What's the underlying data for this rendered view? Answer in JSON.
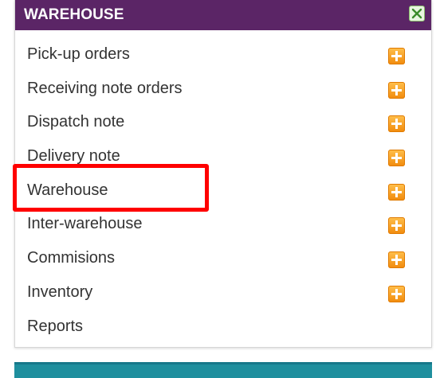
{
  "panel": {
    "title": "WAREHOUSE",
    "header_color": "#5b2566",
    "close_icon": "close-icon"
  },
  "menu": {
    "items": [
      {
        "label": "Pick-up orders",
        "has_add": true
      },
      {
        "label": "Receiving note orders",
        "has_add": true
      },
      {
        "label": "Dispatch note",
        "has_add": true
      },
      {
        "label": "Delivery note",
        "has_add": true
      },
      {
        "label": "Warehouse",
        "has_add": true,
        "highlighted": true
      },
      {
        "label": "Inter-warehouse",
        "has_add": true
      },
      {
        "label": "Commisions",
        "has_add": true
      },
      {
        "label": "Inventory",
        "has_add": true
      },
      {
        "label": "Reports",
        "has_add": false
      }
    ],
    "add_icon": "plus-icon",
    "add_icon_color": "#f39a1e"
  },
  "highlight": {
    "color": "#ff0000"
  },
  "next_panel": {
    "color": "#1f8f9e"
  }
}
